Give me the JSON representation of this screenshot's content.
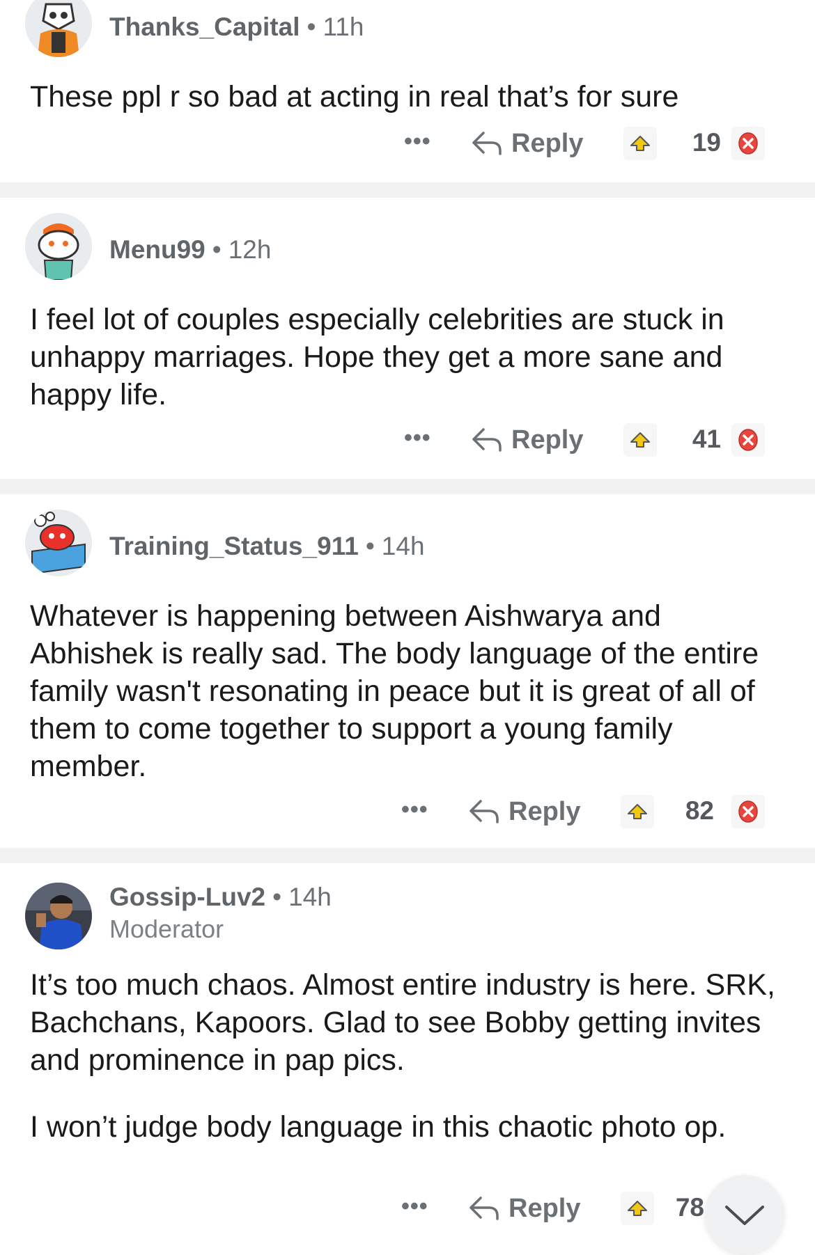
{
  "reply_label": "Reply",
  "more_label": "•••",
  "comments": [
    {
      "user": "Thanks_Capital",
      "age": "11h",
      "role": "",
      "paragraphs": [
        "These ppl r so bad at acting in real that’s for sure"
      ],
      "votes": "19"
    },
    {
      "user": "Menu99",
      "age": "12h",
      "role": "",
      "paragraphs": [
        "I feel lot of couples especially celebrities are stuck in unhappy marriages. Hope they get a more sane and happy life."
      ],
      "votes": "41"
    },
    {
      "user": "Training_Status_911",
      "age": "14h",
      "role": "",
      "paragraphs": [
        "Whatever is happening between Aishwarya and Abhishek is really sad. The body language of the entire family wasn't resonating in peace but it is great of all of them to come together to support a young family member."
      ],
      "votes": "82"
    },
    {
      "user": "Gossip-Luv2",
      "age": "14h",
      "role": "Moderator",
      "paragraphs": [
        "It’s too much chaos. Almost entire industry is here. SRK, Bachchans, Kapoors. Glad to see Bobby getting invites and prominence in pap pics.",
        "I won’t judge body language in this chaotic photo op."
      ],
      "votes": "78"
    }
  ],
  "colors": {
    "upvote": "#e6b800",
    "downvote": "#e8453c",
    "divider": "#f2f2f3",
    "meta": "#6b7075"
  },
  "icons": {
    "reply": "reply-arrow-icon",
    "upvote": "award-upvote-icon",
    "downvote": "downvote-x-icon",
    "scroll": "chevron-down-icon"
  }
}
